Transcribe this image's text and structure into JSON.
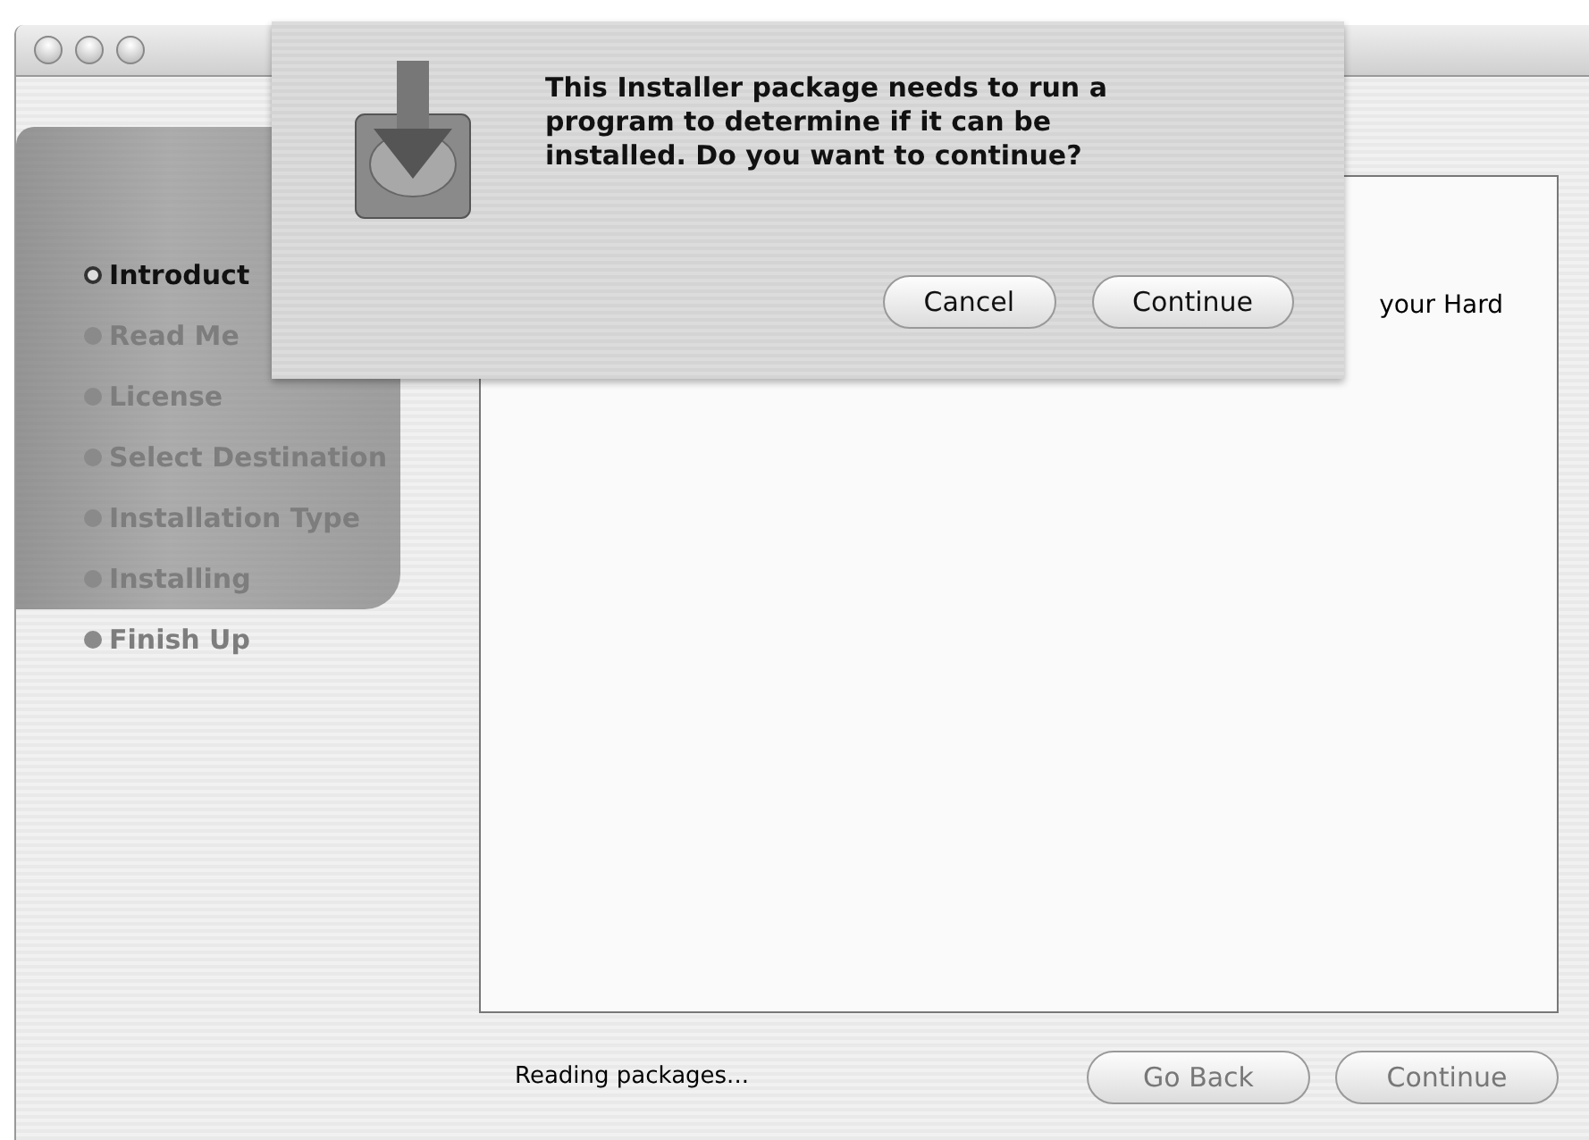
{
  "sidebar": {
    "items": [
      {
        "label": "Introduct",
        "selected": true,
        "disabled": false
      },
      {
        "label": "Read Me",
        "selected": false,
        "disabled": true
      },
      {
        "label": "License",
        "selected": false,
        "disabled": true
      },
      {
        "label": "Select Destination",
        "selected": false,
        "disabled": true
      },
      {
        "label": "Installation Type",
        "selected": false,
        "disabled": true
      },
      {
        "label": "Installing",
        "selected": false,
        "disabled": true
      },
      {
        "label": "Finish Up",
        "selected": false,
        "disabled": true
      }
    ]
  },
  "content": {
    "text": "your Hard"
  },
  "status": "Reading packages...",
  "buttons": [
    {
      "label": "Go Back",
      "disabled": true
    },
    {
      "label": "Continue",
      "disabled": true
    }
  ],
  "sheet": {
    "message": "This Installer package needs to run a program to determine if it can be installed. Do you want to continue?",
    "buttons": [
      {
        "label": "Cancel",
        "default": false
      },
      {
        "label": "Continue",
        "default": false
      }
    ]
  }
}
